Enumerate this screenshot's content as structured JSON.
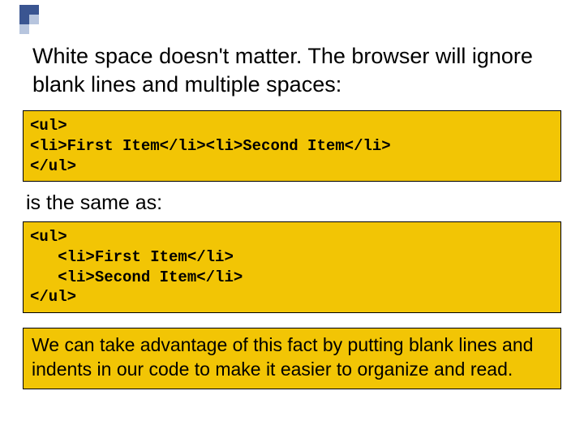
{
  "intro": "White space doesn't matter. The browser will ignore blank lines and multiple spaces:",
  "code1": "<ul>\n<li>First Item</li><li>Second Item</li>\n</ul>",
  "mid": "is the same as:",
  "code2": "<ul>\n   <li>First Item</li>\n   <li>Second Item</li>\n</ul>",
  "outro": "We can take advantage of this fact by putting blank lines and indents in our code to make it easier to organize and read."
}
